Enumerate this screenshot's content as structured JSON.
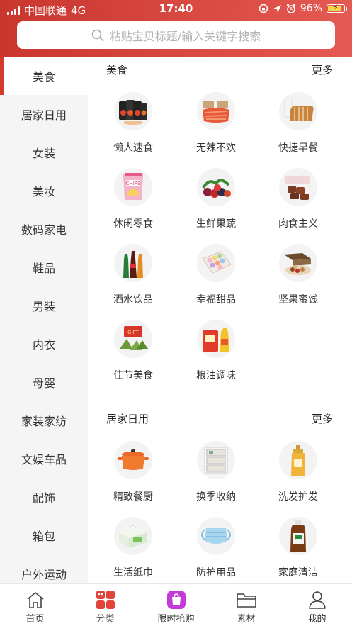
{
  "status_bar": {
    "carrier": "中国联通",
    "network": "4G",
    "time": "17:40",
    "battery": "96%",
    "battery_level": 0.96
  },
  "search": {
    "placeholder": "粘贴宝贝标题/输入关键字搜索"
  },
  "sidebar": {
    "active_index": 0,
    "items": [
      "美食",
      "居家日用",
      "女装",
      "美妆",
      "数码家电",
      "鞋品",
      "男装",
      "内衣",
      "母婴",
      "家装家纺",
      "文娱车品",
      "配饰",
      "箱包",
      "户外运动"
    ]
  },
  "sections": [
    {
      "title": "美食",
      "more": "更多",
      "items": [
        {
          "label": "懒人速食",
          "icon": "instant-food-icon"
        },
        {
          "label": "无辣不欢",
          "icon": "spicy-snack-icon"
        },
        {
          "label": "快捷早餐",
          "icon": "bread-milk-icon"
        },
        {
          "label": "休闲零食",
          "icon": "snack-bag-icon"
        },
        {
          "label": "生鲜果蔬",
          "icon": "fresh-fruit-icon"
        },
        {
          "label": "肉食主义",
          "icon": "meat-icon"
        },
        {
          "label": "酒水饮品",
          "icon": "drink-bottles-icon"
        },
        {
          "label": "幸福甜品",
          "icon": "macaron-box-icon"
        },
        {
          "label": "坚果蜜饯",
          "icon": "nuts-box-icon"
        },
        {
          "label": "佳节美食",
          "icon": "zongzi-icon"
        },
        {
          "label": "粮油调味",
          "icon": "rice-oil-icon"
        }
      ]
    },
    {
      "title": "居家日用",
      "more": "更多",
      "items": [
        {
          "label": "精致餐厨",
          "icon": "cook-pot-icon"
        },
        {
          "label": "换季收纳",
          "icon": "storage-drawer-icon"
        },
        {
          "label": "洗发护发",
          "icon": "shampoo-bottle-icon"
        },
        {
          "label": "生活纸巾",
          "icon": "tissue-pack-icon"
        },
        {
          "label": "防护用品",
          "icon": "face-mask-icon"
        },
        {
          "label": "家庭清洁",
          "icon": "disinfectant-icon"
        }
      ]
    }
  ],
  "tabbar": {
    "active_index": 1,
    "items": [
      {
        "label": "首页",
        "icon": "home-icon"
      },
      {
        "label": "分类",
        "icon": "category-icon"
      },
      {
        "label": "限时抢购",
        "icon": "flash-sale-bag-icon"
      },
      {
        "label": "素材",
        "icon": "folder-icon"
      },
      {
        "label": "我的",
        "icon": "user-icon"
      }
    ]
  },
  "colors": {
    "accent": "#d33b31",
    "header_start": "#c9362e",
    "header_end": "#e45a52",
    "flash_sale": "#c43bd8"
  }
}
